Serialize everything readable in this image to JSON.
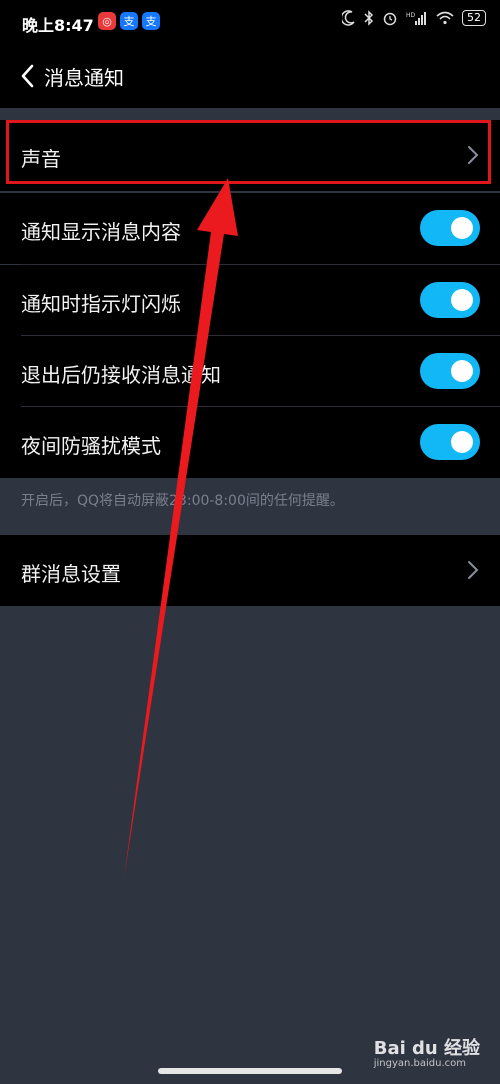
{
  "status_bar": {
    "time": "晚上8:47",
    "app_icons": [
      "netease-music-icon",
      "alipay-icon",
      "alipay-icon"
    ],
    "battery": "52",
    "hd_label": "HD"
  },
  "header": {
    "title": "消息通知"
  },
  "settings": {
    "sound": {
      "label": "声音"
    },
    "toggles": [
      {
        "label": "通知显示消息内容",
        "on": true
      },
      {
        "label": "通知时指示灯闪烁",
        "on": true
      },
      {
        "label": "退出后仍接收消息通知",
        "on": true
      },
      {
        "label": "夜间防骚扰模式",
        "on": true
      }
    ],
    "hint": "开启后，QQ将自动屏蔽23:00-8:00间的任何提醒。",
    "group": {
      "label": "群消息设置"
    }
  },
  "watermark": {
    "brand": "Bai du 经验",
    "url": "jingyan.baidu.com"
  },
  "colors": {
    "toggle_on": "#12b7f5",
    "highlight": "#e1161c",
    "background": "#2f3441"
  }
}
